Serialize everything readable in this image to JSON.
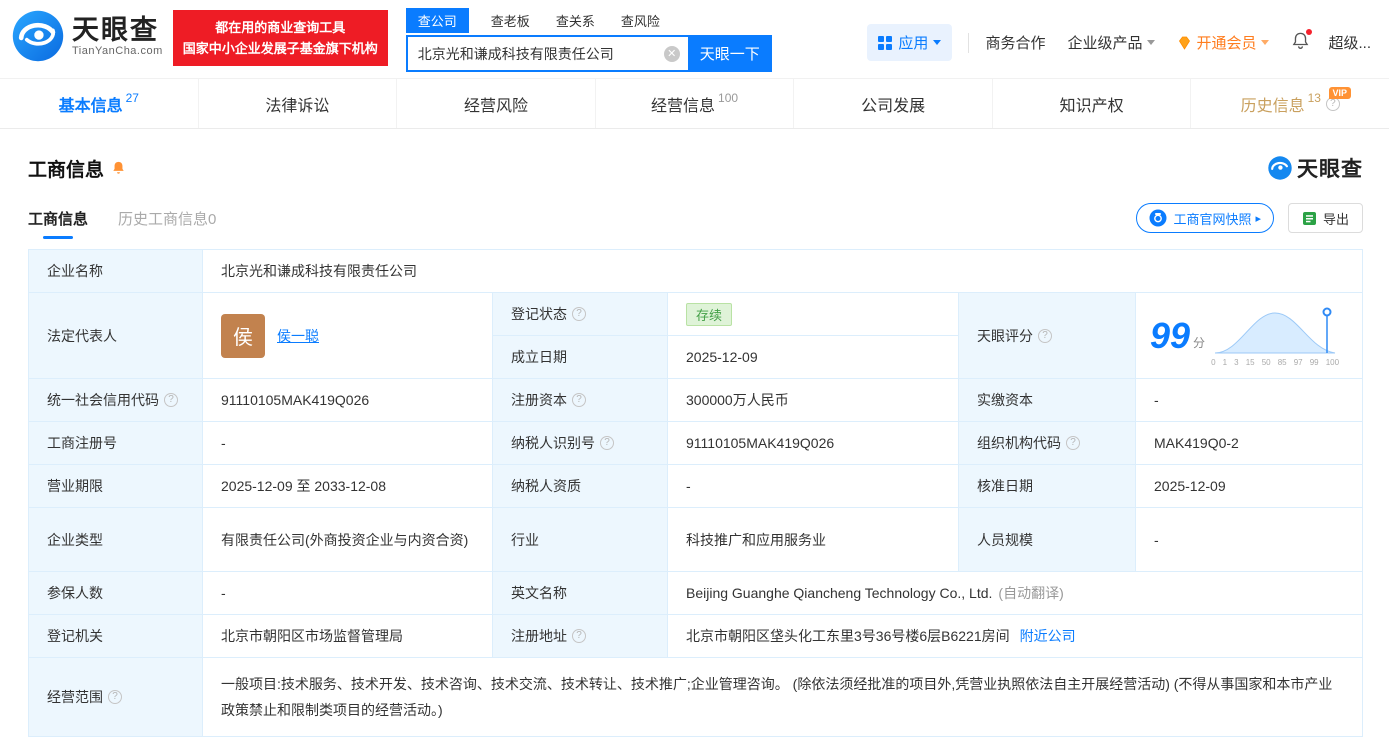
{
  "header": {
    "logo_title": "天眼查",
    "logo_domain": "TianYanCha.com",
    "banner_line1": "都在用的商业查询工具",
    "banner_line2": "国家中小企业发展子基金旗下机构",
    "search_tabs": [
      {
        "label": "查公司",
        "active": true
      },
      {
        "label": "查老板",
        "active": false
      },
      {
        "label": "查关系",
        "active": false
      },
      {
        "label": "查风险",
        "active": false
      }
    ],
    "search_value": "北京光和谦成科技有限责任公司",
    "search_button": "天眼一下",
    "apps_label": "应用",
    "nav_business": "商务合作",
    "nav_enterprise": "企业级产品",
    "nav_vip": "开通会员",
    "nav_super": "超级..."
  },
  "anchor_tabs": [
    {
      "label": "基本信息",
      "count": "27"
    },
    {
      "label": "法律诉讼",
      "count": ""
    },
    {
      "label": "经营风险",
      "count": ""
    },
    {
      "label": "经营信息",
      "count": "100"
    },
    {
      "label": "公司发展",
      "count": ""
    },
    {
      "label": "知识产权",
      "count": ""
    },
    {
      "label": "历史信息",
      "count": "13",
      "vip": "VIP"
    }
  ],
  "section": {
    "title": "工商信息",
    "tab_current": "工商信息",
    "tab_history": "历史工商信息0",
    "snapshot_button": "工商官网快照",
    "export_button": "导出",
    "logo_text": "天眼查"
  },
  "info": {
    "company_name": {
      "label": "企业名称",
      "value": "北京光和谦成科技有限责任公司"
    },
    "legal_rep": {
      "label": "法定代表人",
      "name": "侯一聪",
      "avatar": "侯"
    },
    "reg_status": {
      "label": "登记状态",
      "value": "存续"
    },
    "establish_date": {
      "label": "成立日期",
      "value": "2025-12-09"
    },
    "score": {
      "label": "天眼评分",
      "value": "99",
      "unit": "分",
      "ticks": [
        "0",
        "1",
        "3",
        "15",
        "50",
        "85",
        "97",
        "99",
        "100"
      ]
    },
    "credit_code": {
      "label": "统一社会信用代码",
      "value": "91110105MAK419Q026"
    },
    "reg_capital": {
      "label": "注册资本",
      "value": "300000万人民币"
    },
    "paid_capital": {
      "label": "实缴资本",
      "value": "-"
    },
    "reg_number": {
      "label": "工商注册号",
      "value": "-"
    },
    "taxpayer_id": {
      "label": "纳税人识别号",
      "value": "91110105MAK419Q026"
    },
    "org_code": {
      "label": "组织机构代码",
      "value": "MAK419Q0-2"
    },
    "business_term": {
      "label": "营业期限",
      "value": "2025-12-09 至 2033-12-08"
    },
    "taxpayer_quality": {
      "label": "纳税人资质",
      "value": "-"
    },
    "approval_date": {
      "label": "核准日期",
      "value": "2025-12-09"
    },
    "company_type": {
      "label": "企业类型",
      "value": "有限责任公司(外商投资企业与内资合资)"
    },
    "industry": {
      "label": "行业",
      "value": "科技推广和应用服务业"
    },
    "staff_size": {
      "label": "人员规模",
      "value": "-"
    },
    "insured_count": {
      "label": "参保人数",
      "value": "-"
    },
    "english_name": {
      "label": "英文名称",
      "value": "Beijing Guanghe Qiancheng Technology Co., Ltd.",
      "note": "(自动翻译)"
    },
    "reg_authority": {
      "label": "登记机关",
      "value": "北京市朝阳区市场监督管理局"
    },
    "reg_address": {
      "label": "注册地址",
      "value": "北京市朝阳区垡头化工东里3号36号楼6层B6221房间",
      "link": "附近公司"
    },
    "business_scope": {
      "label": "经营范围",
      "value": "一般项目:技术服务、技术开发、技术咨询、技术交流、技术转让、技术推广;企业管理咨询。 (除依法须经批准的项目外,凭营业执照依法自主开展经营活动) (不得从事国家和本市产业政策禁止和限制类项目的经营活动。)"
    }
  }
}
